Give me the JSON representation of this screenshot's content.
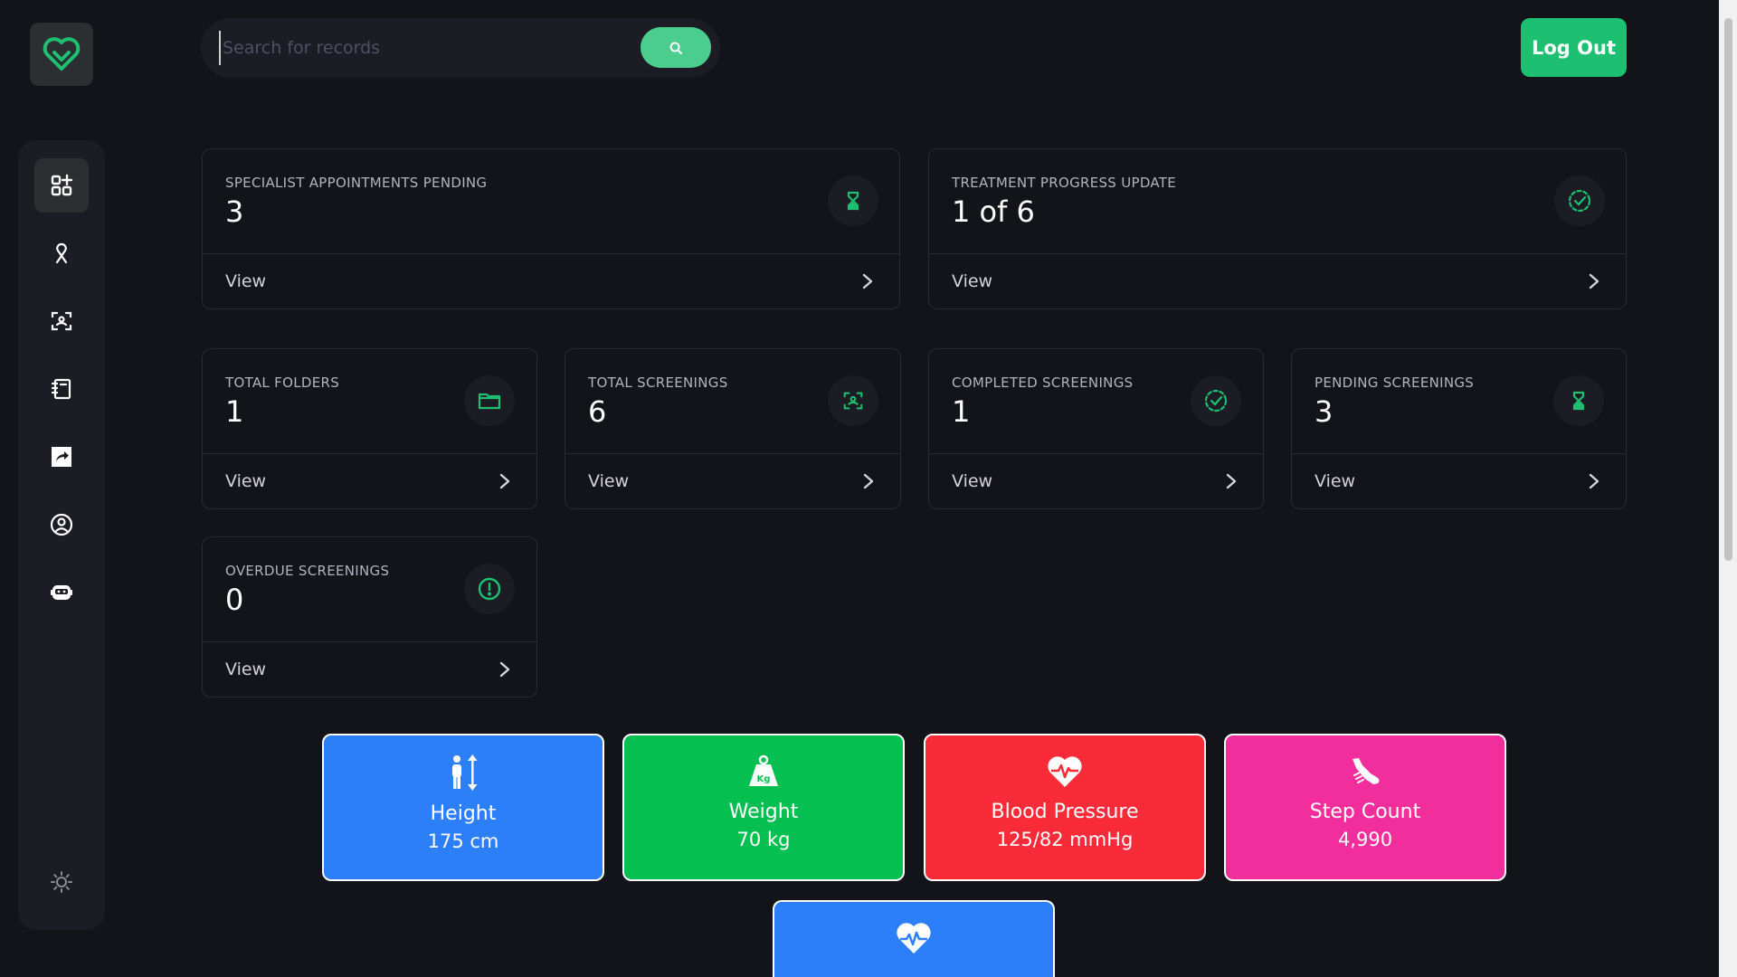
{
  "header": {
    "search_placeholder": "Search for records",
    "search_value": "",
    "logout_label": "Log Out"
  },
  "sidebar": {
    "items": [
      {
        "name": "dashboard",
        "icon": "dashboard-grid-icon",
        "active": true
      },
      {
        "name": "ribbon",
        "icon": "awareness-ribbon-icon",
        "active": false
      },
      {
        "name": "screening",
        "icon": "scan-person-icon",
        "active": false
      },
      {
        "name": "records",
        "icon": "notebook-icon",
        "active": false
      },
      {
        "name": "share",
        "icon": "share-box-icon",
        "active": false
      },
      {
        "name": "profile",
        "icon": "user-circle-icon",
        "active": false
      },
      {
        "name": "assistant",
        "icon": "robot-icon",
        "active": false
      }
    ],
    "theme_icon": "sun-icon"
  },
  "cards_top": [
    {
      "label": "SPECIALIST APPOINTMENTS PENDING",
      "value": "3",
      "icon": "hourglass-icon",
      "link": "View"
    },
    {
      "label": "TREATMENT PROGRESS UPDATE",
      "value": "1 of 6",
      "icon": "check-circle-dashed-icon",
      "link": "View"
    }
  ],
  "cards_row": [
    {
      "label": "TOTAL FOLDERS",
      "value": "1",
      "icon": "folder-icon",
      "link": "View"
    },
    {
      "label": "TOTAL SCREENINGS",
      "value": "6",
      "icon": "scan-person-icon",
      "link": "View"
    },
    {
      "label": "COMPLETED SCREENINGS",
      "value": "1",
      "icon": "check-circle-dashed-icon",
      "link": "View"
    },
    {
      "label": "PENDING SCREENINGS",
      "value": "3",
      "icon": "hourglass-icon",
      "link": "View"
    }
  ],
  "card_overdue": {
    "label": "OVERDUE SCREENINGS",
    "value": "0",
    "icon": "alert-circle-icon",
    "link": "View"
  },
  "metrics": [
    {
      "title": "Height",
      "value": "175 cm",
      "color": "#2d7ff9",
      "icon": "height-icon"
    },
    {
      "title": "Weight",
      "value": "70 kg",
      "color": "#05c050",
      "icon": "weight-icon"
    },
    {
      "title": "Blood Pressure",
      "value": "125/82 mmHg",
      "color": "#fa2b39",
      "icon": "heart-pulse-icon"
    },
    {
      "title": "Step Count",
      "value": "4,990",
      "color": "#f22e9c",
      "icon": "shoe-icon"
    },
    {
      "title": "",
      "value": "",
      "color": "#2d7ff9",
      "icon": "heart-rate-icon"
    }
  ],
  "colors": {
    "accent": "#1dc071",
    "icon_green": "#1dc071",
    "background": "#13131a",
    "panel": "#1c1c24"
  }
}
